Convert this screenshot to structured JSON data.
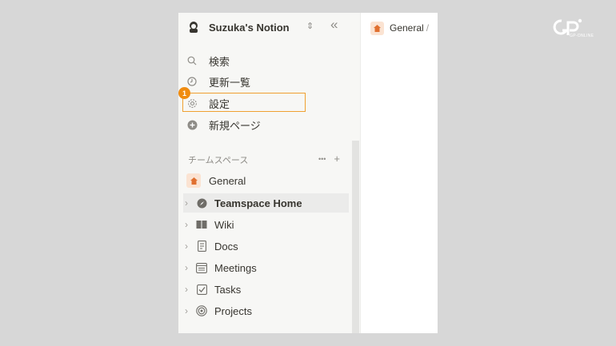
{
  "workspace": {
    "name": "Suzuka's Notion"
  },
  "menu": {
    "search": "検索",
    "updates": "更新一覧",
    "settings": "設定",
    "new_page": "新規ページ"
  },
  "annotation": {
    "step": "1"
  },
  "teamspaces": {
    "heading": "チームスペース",
    "more": "•••",
    "add": "+",
    "general": "General",
    "items": [
      {
        "label": "Teamspace Home",
        "icon": "compass-icon"
      },
      {
        "label": "Wiki",
        "icon": "book-icon"
      },
      {
        "label": "Docs",
        "icon": "document-icon"
      },
      {
        "label": "Meetings",
        "icon": "calendar-icon"
      },
      {
        "label": "Tasks",
        "icon": "checkbox-icon"
      },
      {
        "label": "Projects",
        "icon": "target-icon"
      }
    ]
  },
  "breadcrumb": {
    "page": "General",
    "separator": "/"
  },
  "logo": {
    "text": "GP-ONLINE"
  },
  "colors": {
    "accent": "#f08c10",
    "house": "#e07030"
  }
}
